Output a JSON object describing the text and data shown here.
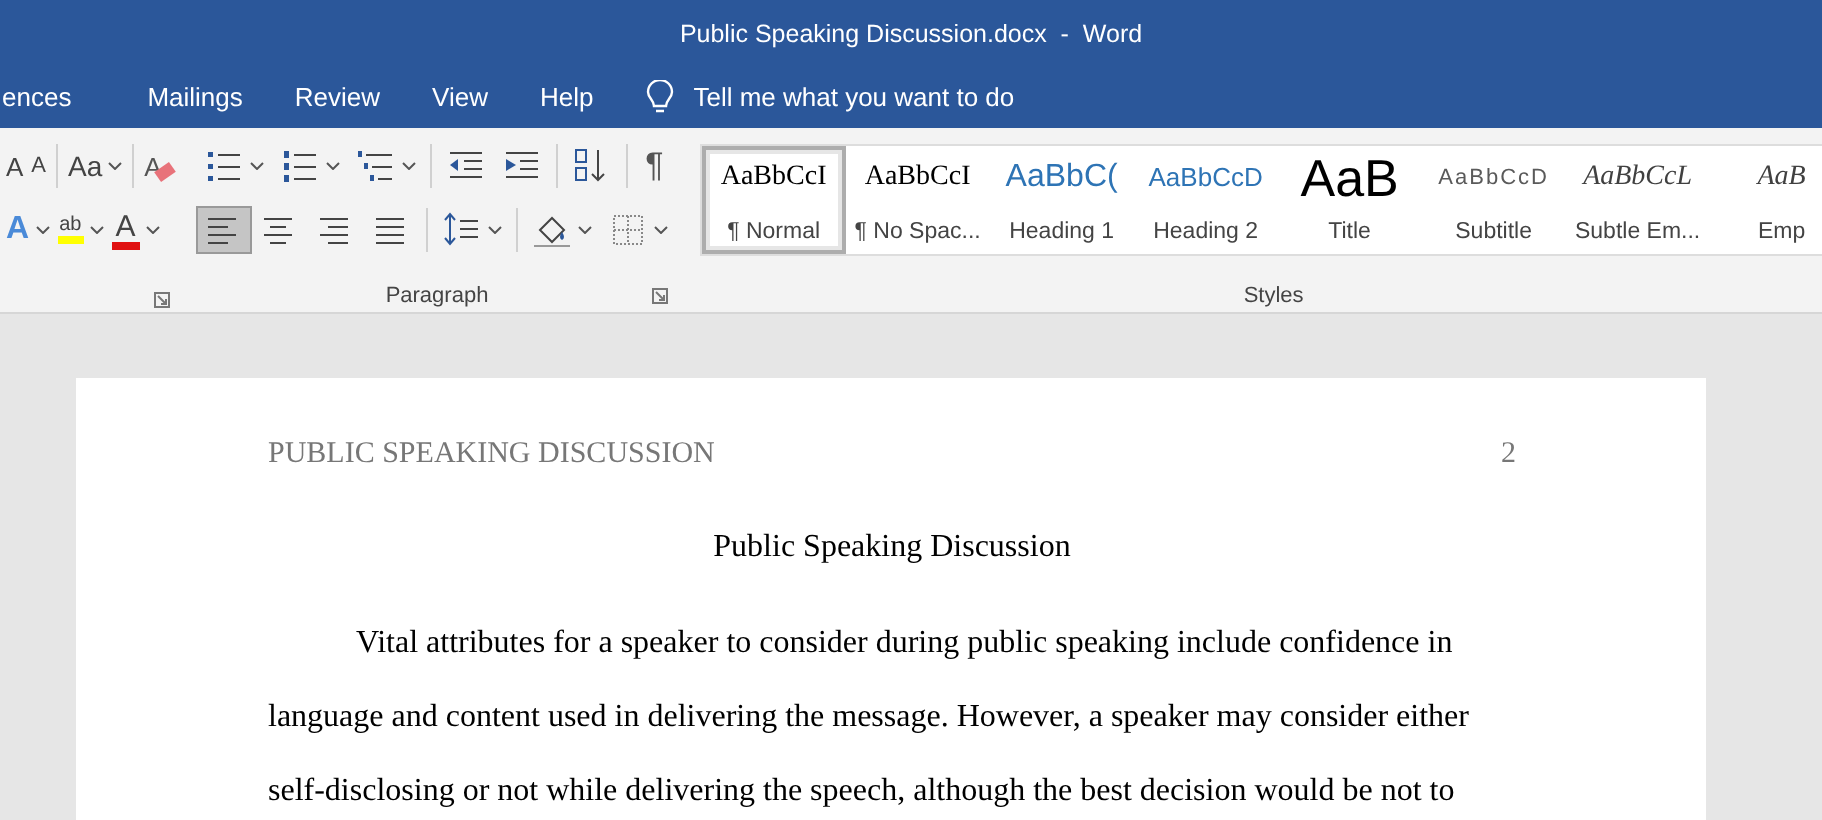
{
  "window": {
    "title": "Public Speaking Discussion.docx  -  Word"
  },
  "tabs": [
    {
      "label": "ences",
      "selected": false
    },
    {
      "label": "Mailings",
      "selected": false
    },
    {
      "label": "Review",
      "selected": false
    },
    {
      "label": "View",
      "selected": false
    },
    {
      "label": "Help",
      "selected": false
    }
  ],
  "tell_me": {
    "placeholder": "Tell me what you want to do"
  },
  "font_group": {
    "row1": [
      {
        "kind": "grow",
        "glyph": "A",
        "dropdown": false
      },
      {
        "kind": "shrink",
        "glyph": "A",
        "dropdown": false
      },
      {
        "kind": "case",
        "glyph": "Aa",
        "dropdown": true
      },
      {
        "kind": "clear",
        "glyph": "A",
        "dropdown": false
      }
    ],
    "row2": [
      {
        "kind": "effects",
        "glyph": "A",
        "dropdown": true
      },
      {
        "kind": "highlight",
        "glyph": "ab",
        "dropdown": true
      },
      {
        "kind": "color",
        "glyph": "A",
        "dropdown": true
      }
    ]
  },
  "paragraph_group": {
    "label": "Paragraph",
    "row1": [
      {
        "kind": "bullets",
        "dropdown": true
      },
      {
        "kind": "numbering",
        "dropdown": true
      },
      {
        "kind": "multilevel",
        "dropdown": true
      },
      {
        "kind": "sep"
      },
      {
        "kind": "outdent",
        "dropdown": false
      },
      {
        "kind": "indent",
        "dropdown": false
      },
      {
        "kind": "sep"
      },
      {
        "kind": "sort",
        "dropdown": false
      },
      {
        "kind": "sep"
      },
      {
        "kind": "marks",
        "glyph": "¶",
        "dropdown": false
      }
    ],
    "row2": [
      {
        "kind": "align-left",
        "dropdown": false,
        "selected": true
      },
      {
        "kind": "align-center",
        "dropdown": false,
        "selected": false
      },
      {
        "kind": "align-right",
        "dropdown": false,
        "selected": false
      },
      {
        "kind": "justify",
        "dropdown": false,
        "selected": false
      },
      {
        "kind": "sep"
      },
      {
        "kind": "spacing",
        "dropdown": true
      },
      {
        "kind": "sep"
      },
      {
        "kind": "shading",
        "dropdown": true
      },
      {
        "kind": "borders",
        "dropdown": true
      }
    ]
  },
  "styles_group": {
    "label": "Styles",
    "styles": [
      {
        "preview": "AaBbCcI",
        "label": "¶ Normal",
        "kind": "normal",
        "selected": true
      },
      {
        "preview": "AaBbCcI",
        "label": "¶ No Spac...",
        "kind": "normal",
        "selected": false
      },
      {
        "preview": "AaBbC(",
        "label": "Heading 1",
        "kind": "heading1",
        "selected": false
      },
      {
        "preview": "AaBbCcD",
        "label": "Heading 2",
        "kind": "heading2",
        "selected": false
      },
      {
        "preview": "AaB",
        "label": "Title",
        "kind": "title",
        "selected": false
      },
      {
        "preview": "AaBbCcD",
        "label": "Subtitle",
        "kind": "subtitle",
        "selected": false
      },
      {
        "preview": "AaBbCcL",
        "label": "Subtle Em...",
        "kind": "emphasis",
        "selected": false
      },
      {
        "preview": "AaB",
        "label": "Emp",
        "kind": "emphasis",
        "selected": false
      }
    ]
  },
  "document": {
    "header": "PUBLIC SPEAKING DISCUSSION",
    "page_number": "2",
    "title": "Public Speaking Discussion",
    "lines": [
      "Vital attributes for a speaker to consider during public speaking include confidence in",
      "language and content used in delivering the message. However, a speaker may consider either",
      "self-disclosing or not while delivering the speech, although the best decision would be not to"
    ]
  }
}
